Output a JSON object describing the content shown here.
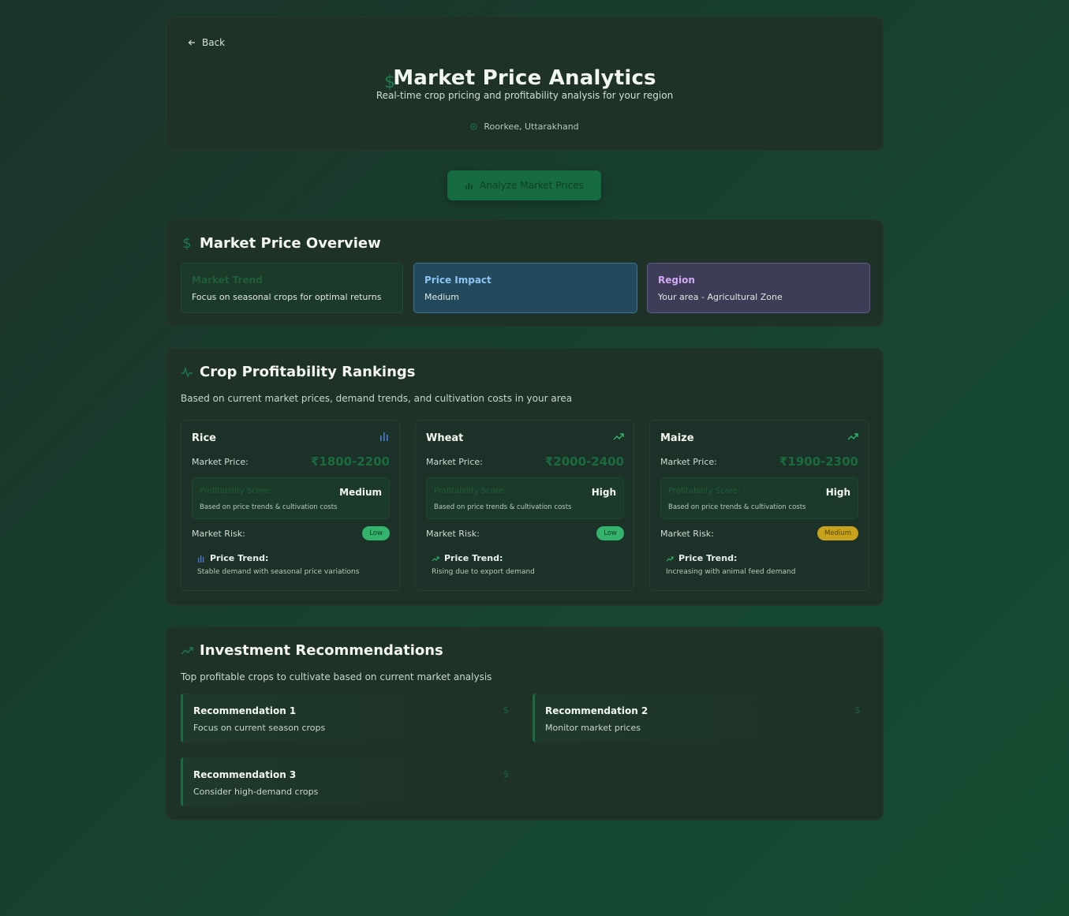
{
  "header": {
    "back_label": "Back",
    "title": "Market Price Analytics",
    "subtitle": "Real-time crop pricing and profitability analysis for your region",
    "location": "Roorkee, Uttarakhand"
  },
  "analyze_button": {
    "label": "Analyze Market Prices"
  },
  "overview": {
    "title": "Market Price Overview",
    "cards": [
      {
        "heading": "Market Trend",
        "value": "Focus on seasonal crops for optimal returns"
      },
      {
        "heading": "Price Impact",
        "value": "Medium"
      },
      {
        "heading": "Region",
        "value": "Your area - Agricultural Zone"
      }
    ]
  },
  "rankings": {
    "title": "Crop Profitability Rankings",
    "description": "Based on current market prices, demand trends, and cultivation costs in your area",
    "crops": [
      {
        "name": "Rice",
        "trend_icon": "bar-chart-icon",
        "trend_color": "#4a7bd8",
        "market_price_label": "Market Price:",
        "market_price": "₹1800-2200",
        "score_label": "Profitability Score:",
        "score": "Medium",
        "score_note": "Based on price trends & cultivation costs",
        "risk_label": "Market Risk:",
        "risk": "Low",
        "trend_label": "Price Trend:",
        "trend_desc": "Stable demand with seasonal price variations"
      },
      {
        "name": "Wheat",
        "trend_icon": "trending-up-icon",
        "trend_color": "#2fb36b",
        "market_price_label": "Market Price:",
        "market_price": "₹2000-2400",
        "score_label": "Profitability Score:",
        "score": "High",
        "score_note": "Based on price trends & cultivation costs",
        "risk_label": "Market Risk:",
        "risk": "Low",
        "trend_label": "Price Trend:",
        "trend_desc": "Rising due to export demand"
      },
      {
        "name": "Maize",
        "trend_icon": "trending-up-icon",
        "trend_color": "#2fb36b",
        "market_price_label": "Market Price:",
        "market_price": "₹1900-2300",
        "score_label": "Profitability Score:",
        "score": "High",
        "score_note": "Based on price trends & cultivation costs",
        "risk_label": "Market Risk:",
        "risk": "Medium",
        "trend_label": "Price Trend:",
        "trend_desc": "Increasing with animal feed demand"
      }
    ]
  },
  "recommendations": {
    "title": "Investment Recommendations",
    "description": "Top profitable crops to cultivate based on current market analysis",
    "items": [
      {
        "title": "Recommendation 1",
        "desc": "Focus on current season crops"
      },
      {
        "title": "Recommendation 2",
        "desc": "Monitor market prices"
      },
      {
        "title": "Recommendation 3",
        "desc": "Consider high-demand crops"
      }
    ]
  },
  "icons": {
    "dollar": "$"
  }
}
